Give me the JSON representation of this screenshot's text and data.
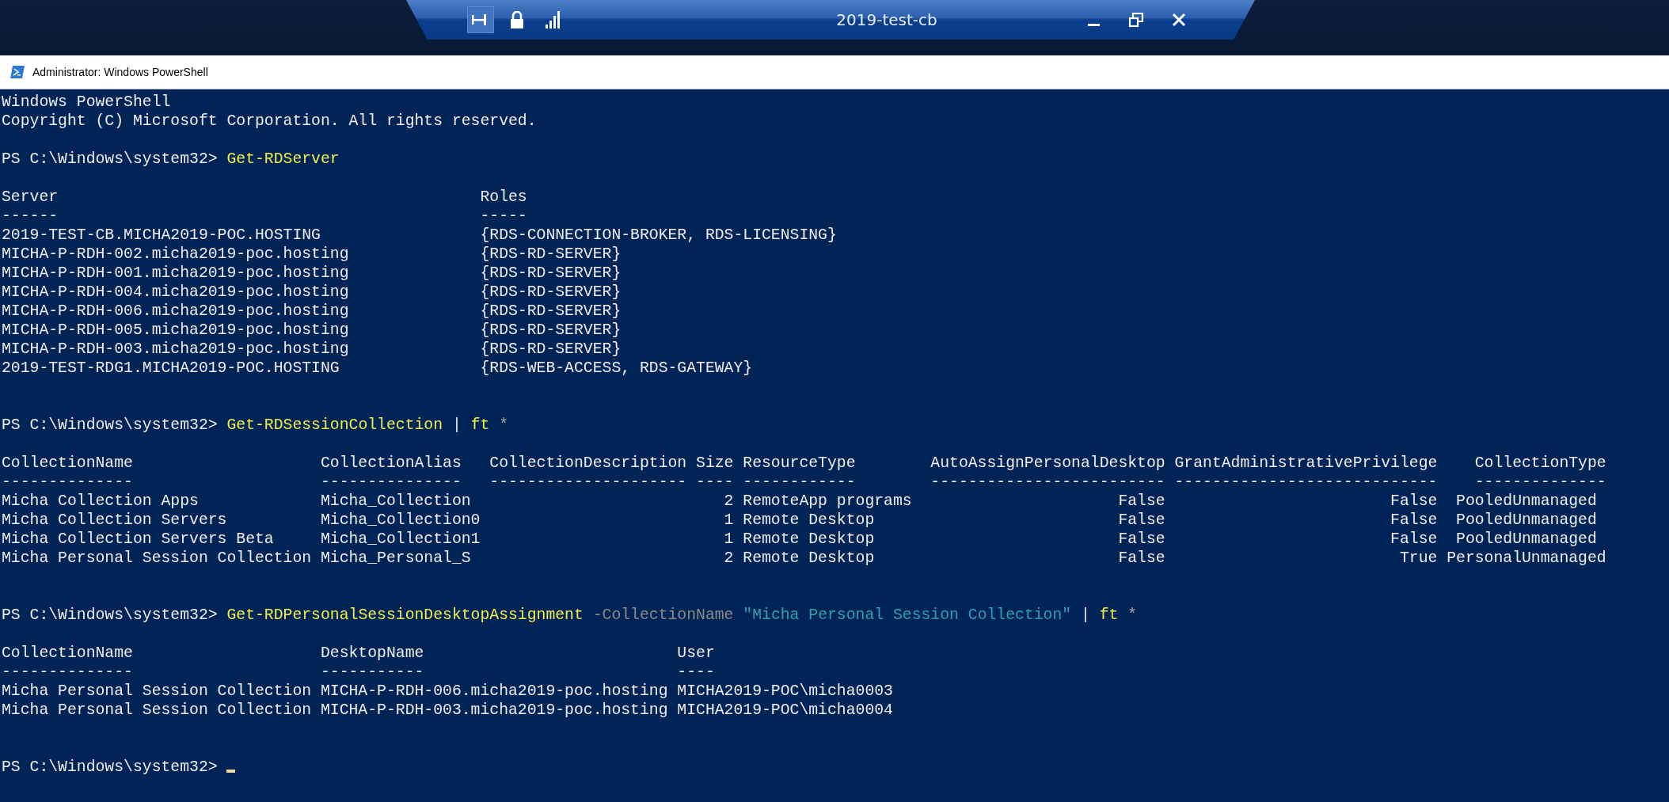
{
  "connection_bar": {
    "title": "2019-test-cb",
    "pinned": true
  },
  "window": {
    "title": "Administrator: Windows PowerShell"
  },
  "console": {
    "banner": [
      "Windows PowerShell",
      "Copyright (C) Microsoft Corporation. All rights reserved."
    ],
    "sessions": [
      {
        "prompt": "PS C:\\Windows\\system32>",
        "command": [
          {
            "kind": "command",
            "text": "Get-RDServer"
          }
        ],
        "output": [
          "Server                                             Roles",
          "------                                             -----",
          "2019-TEST-CB.MICHA2019-POC.HOSTING                 {RDS-CONNECTION-BROKER, RDS-LICENSING}",
          "MICHA-P-RDH-002.micha2019-poc.hosting              {RDS-RD-SERVER}",
          "MICHA-P-RDH-001.micha2019-poc.hosting              {RDS-RD-SERVER}",
          "MICHA-P-RDH-004.micha2019-poc.hosting              {RDS-RD-SERVER}",
          "MICHA-P-RDH-006.micha2019-poc.hosting              {RDS-RD-SERVER}",
          "MICHA-P-RDH-005.micha2019-poc.hosting              {RDS-RD-SERVER}",
          "MICHA-P-RDH-003.micha2019-poc.hosting              {RDS-RD-SERVER}",
          "2019-TEST-RDG1.MICHA2019-POC.HOSTING               {RDS-WEB-ACCESS, RDS-GATEWAY}"
        ]
      },
      {
        "prompt": "PS C:\\Windows\\system32>",
        "command": [
          {
            "kind": "command",
            "text": "Get-RDSessionCollection"
          },
          {
            "kind": "operator",
            "text": "|"
          },
          {
            "kind": "command",
            "text": "ft"
          },
          {
            "kind": "argument",
            "text": "*"
          }
        ],
        "output": [
          "CollectionName                    CollectionAlias   CollectionDescription Size ResourceType        AutoAssignPersonalDesktop GrantAdministrativePrivilege    CollectionType",
          "--------------                    ---------------   --------------------- ---- ------------        ------------------------- ----------------------------    --------------",
          "Micha Collection Apps             Micha_Collection                           2 RemoteApp programs                      False                        False  PooledUnmanaged",
          "Micha Collection Servers          Micha_Collection0                          1 Remote Desktop                          False                        False  PooledUnmanaged",
          "Micha Collection Servers Beta     Micha_Collection1                          1 Remote Desktop                          False                        False  PooledUnmanaged",
          "Micha Personal Session Collection Micha_Personal_S                           2 Remote Desktop                          False                         True PersonalUnmanaged"
        ]
      },
      {
        "prompt": "PS C:\\Windows\\system32>",
        "command": [
          {
            "kind": "command",
            "text": "Get-RDPersonalSessionDesktopAssignment"
          },
          {
            "kind": "parameter",
            "text": "-CollectionName"
          },
          {
            "kind": "string",
            "text": "\"Micha Personal Session Collection\""
          },
          {
            "kind": "operator",
            "text": "|"
          },
          {
            "kind": "command",
            "text": "ft"
          },
          {
            "kind": "argument",
            "text": "*"
          }
        ],
        "output": [
          "CollectionName                    DesktopName                           User",
          "--------------                    -----------                           ----",
          "Micha Personal Session Collection MICHA-P-RDH-006.micha2019-poc.hosting MICHA2019-POC\\micha0003",
          "Micha Personal Session Collection MICHA-P-RDH-003.micha2019-poc.hosting MICHA2019-POC\\micha0004"
        ]
      }
    ],
    "final_prompt": {
      "prompt": "PS C:\\Windows\\system32>",
      "cursor": true
    }
  }
}
